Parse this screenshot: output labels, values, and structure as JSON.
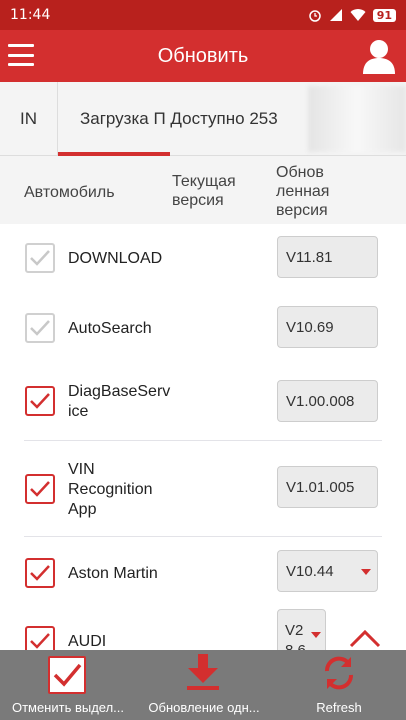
{
  "status_bar": {
    "time": "11:44",
    "battery": "91"
  },
  "app_bar": {
    "title": "Обновить"
  },
  "tabs": [
    {
      "label": "IN"
    },
    {
      "label": "Загрузка П Доступно 253"
    }
  ],
  "columns": {
    "vehicle": "Автомобиль",
    "current_version": "Текущая версия",
    "updated_version": "Обнов ленная версия"
  },
  "rows": [
    {
      "name": "DOWNLOAD",
      "version": "V11.81",
      "checked": true,
      "disabled": true
    },
    {
      "name": "AutoSearch",
      "version": "V10.69",
      "checked": true,
      "disabled": true
    },
    {
      "name": "DiagBaseServ ice",
      "version": "V1.00.008",
      "checked": true,
      "disabled": false
    },
    {
      "name": "VIN Recognition App",
      "version": "V1.01.005",
      "checked": true,
      "disabled": false
    },
    {
      "name": "Aston Martin",
      "version": "V10.44",
      "checked": true,
      "disabled": false,
      "dropdown": true
    },
    {
      "name": "AUDI",
      "version": "V2 8.6",
      "checked": true,
      "disabled": false,
      "dropdown": true
    }
  ],
  "bottom_bar": {
    "cancel_label": "Отменить выдел...",
    "update_label": "Обновление одн...",
    "refresh_label": "Refresh"
  },
  "colors": {
    "accent": "#d32f2f",
    "status": "#b8211d",
    "bottom": "#7a7a7a"
  }
}
